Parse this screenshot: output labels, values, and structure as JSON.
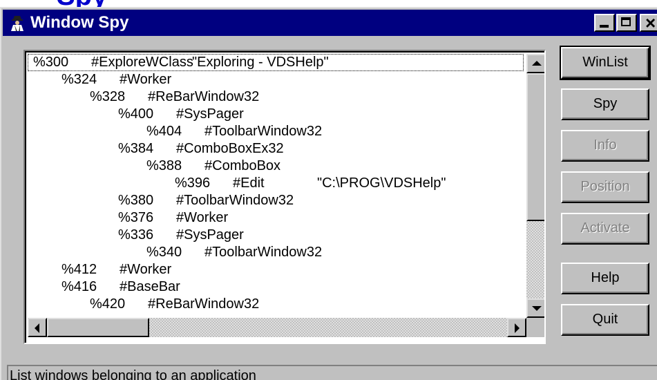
{
  "page": {
    "heading_fragment": "Spy"
  },
  "window": {
    "title": "Window Spy",
    "title_icon": "spy-icon",
    "caption_buttons": {
      "minimize": "minimize-icon",
      "maximize": "maximize-icon",
      "close_glyph": "×"
    }
  },
  "window_tree": {
    "rows": [
      {
        "id": "%300",
        "cls": "#ExploreWClass",
        "caption": "\"Exploring - VDSHelp\"",
        "depth": 0,
        "selected": true
      },
      {
        "id": "%324",
        "cls": "#Worker",
        "caption": "",
        "depth": 1
      },
      {
        "id": "%328",
        "cls": "#ReBarWindow32",
        "caption": "",
        "depth": 2
      },
      {
        "id": "%400",
        "cls": "#SysPager",
        "caption": "",
        "depth": 3
      },
      {
        "id": "%404",
        "cls": "#ToolbarWindow32",
        "caption": "",
        "depth": 4
      },
      {
        "id": "%384",
        "cls": "#ComboBoxEx32",
        "caption": "",
        "depth": 3
      },
      {
        "id": "%388",
        "cls": "#ComboBox",
        "caption": "",
        "depth": 4
      },
      {
        "id": "%396",
        "cls": "#Edit",
        "caption": "\"C:\\PROG\\VDSHelp\"",
        "depth": 5
      },
      {
        "id": "%380",
        "cls": "#ToolbarWindow32",
        "caption": "",
        "depth": 3
      },
      {
        "id": "%376",
        "cls": "#Worker",
        "caption": "",
        "depth": 3
      },
      {
        "id": "%336",
        "cls": "#SysPager",
        "caption": "",
        "depth": 3
      },
      {
        "id": "%340",
        "cls": "#ToolbarWindow32",
        "caption": "",
        "depth": 4
      },
      {
        "id": "%412",
        "cls": "#Worker",
        "caption": "",
        "depth": 1
      },
      {
        "id": "%416",
        "cls": "#BaseBar",
        "caption": "",
        "depth": 1
      },
      {
        "id": "%420",
        "cls": "#ReBarWindow32",
        "caption": "",
        "depth": 2
      }
    ],
    "scroll_icons": {
      "up": "arrow-up-icon",
      "down": "arrow-down-icon",
      "left": "arrow-left-icon",
      "right": "arrow-right-icon"
    }
  },
  "buttons": {
    "winlist": {
      "label": "WinList",
      "enabled": true,
      "default": true
    },
    "spy": {
      "label": "Spy",
      "enabled": true
    },
    "info": {
      "label": "Info",
      "enabled": false
    },
    "position": {
      "label": "Position",
      "enabled": false
    },
    "activate": {
      "label": "Activate",
      "enabled": false
    },
    "help": {
      "label": "Help",
      "enabled": true
    },
    "quit": {
      "label": "Quit",
      "enabled": true
    }
  },
  "status_bar": {
    "text": "List windows belonging to an application"
  },
  "colors": {
    "titlebar": "#000080",
    "face": "#c0c0c0",
    "heading": "#0000cc",
    "disabled_text": "#808080"
  }
}
